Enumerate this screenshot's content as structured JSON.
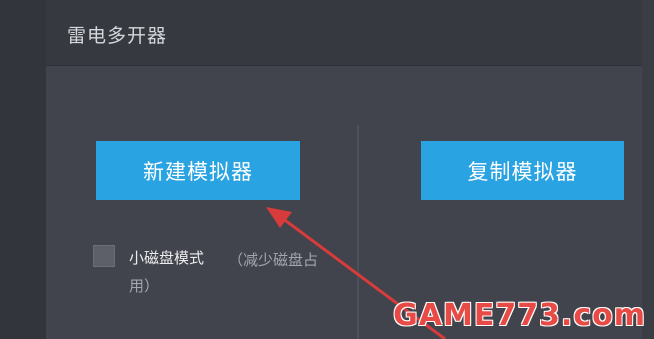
{
  "window": {
    "title": "雷电多开器"
  },
  "actions": {
    "new_emulator": "新建模拟器",
    "copy_emulator": "复制模拟器"
  },
  "small_disk_mode": {
    "label": "小磁盘模式",
    "note": "（减少磁盘占用）",
    "checked": false
  },
  "watermark": "GAME773.com",
  "colors": {
    "button_accent": "#2aa3e2",
    "annotation_arrow": "#d83b3b"
  }
}
